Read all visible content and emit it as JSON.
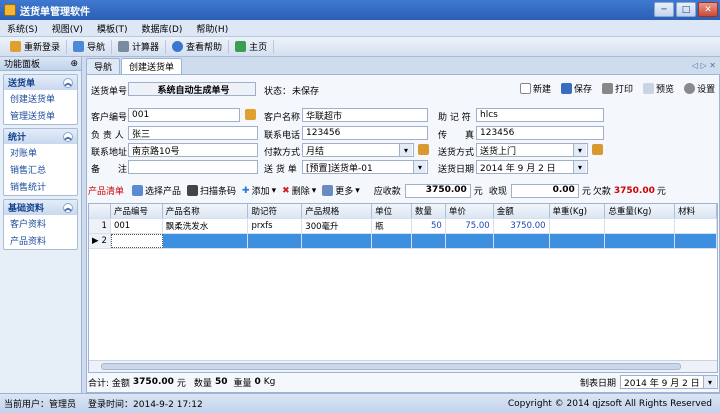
{
  "app": {
    "title": "送货单管理软件"
  },
  "window": {
    "minimize": "─",
    "maximize": "□",
    "close": "✕"
  },
  "menu": [
    "系统(S)",
    "视图(V)",
    "模板(T)",
    "数据库(D)",
    "帮助(H)"
  ],
  "toolbar": {
    "relogin": "重新登录",
    "nav": "导航",
    "calc": "计算器",
    "help": "查看帮助",
    "home": "主页"
  },
  "left_panel": {
    "title": "功能面板",
    "pin": "⊕",
    "groups": [
      {
        "title": "送货单",
        "items": [
          "创建送货单",
          "管理送货单"
        ]
      },
      {
        "title": "统计",
        "items": [
          "对账单",
          "销售汇总",
          "销售统计"
        ]
      },
      {
        "title": "基础资料",
        "items": [
          "客户资料",
          "产品资料"
        ]
      }
    ]
  },
  "tabs": [
    "导航",
    "创建送货单"
  ],
  "tab_nav": "◁ ▷ ✕",
  "doc": {
    "no_label": "送货单号",
    "no_value": "系统自动生成单号",
    "state_label": "状态：",
    "state_value": "未保存",
    "new": "新建",
    "save": "保存",
    "print": "打印",
    "preview": "预览",
    "settings": "设置"
  },
  "form": {
    "cust_no_label": "客户编号",
    "cust_no": "001",
    "cust_name_label": "客户名称",
    "cust_name": "华联超市",
    "mnemonic_label": "助 记 符",
    "mnemonic": "hlcs",
    "owner_label": "负 责 人",
    "owner": "张三",
    "phone_label": "联系电话",
    "phone": "123456",
    "fax_label": "传　　真",
    "fax": "123456",
    "addr_label": "联系地址",
    "addr": "南京路10号",
    "pay_label": "付款方式",
    "pay": "月结",
    "ship_label": "送货方式",
    "ship": "送货上门",
    "note_label": "备　　注",
    "note": "",
    "template_label": "送 货 单",
    "template": "[预置]送货单-01",
    "date_label": "送货日期",
    "date": "2014 年  9 月  2 日"
  },
  "ptoolbar": {
    "list": "产品清单",
    "select": "选择产品",
    "scan": "扫描条码",
    "add": "添加",
    "del": "删除",
    "more": "更多",
    "receivable_label": "应收款",
    "receivable": "3750.00",
    "unit1": "元",
    "received_label": "收现",
    "received": "0.00",
    "unit2": "元",
    "owe_label": "欠款",
    "owe": "3750.00",
    "unit3": "元"
  },
  "grid": {
    "columns": [
      "",
      "产品编号",
      "产品名称",
      "助记符",
      "产品规格",
      "单位",
      "数量",
      "单价",
      "金额",
      "单重(Kg)",
      "总重量(Kg)",
      "材料"
    ],
    "rows": [
      [
        "1",
        "001",
        "飘柔洗发水",
        "prxfs",
        "300毫升",
        "瓶",
        "50",
        "75.00",
        "3750.00",
        "",
        "",
        ""
      ],
      [
        "2",
        "",
        "",
        "",
        "",
        "",
        "",
        "",
        "",
        "",
        "",
        ""
      ]
    ]
  },
  "footer": {
    "text": "合计: 金额",
    "amount": "3750.00",
    "yuan": "元",
    "qty_label": "数量",
    "qty": "50",
    "weight_label": "重量",
    "weight": "0",
    "kg": "Kg",
    "date_label": "制表日期",
    "date": "2014 年  9 月  2 日"
  },
  "status": {
    "user": "当前用户：管理员",
    "login": "登录时间：2014-9-2 17:12",
    "copyright": "Copyright © 2014 qjzsoft All Rights Reserved"
  }
}
